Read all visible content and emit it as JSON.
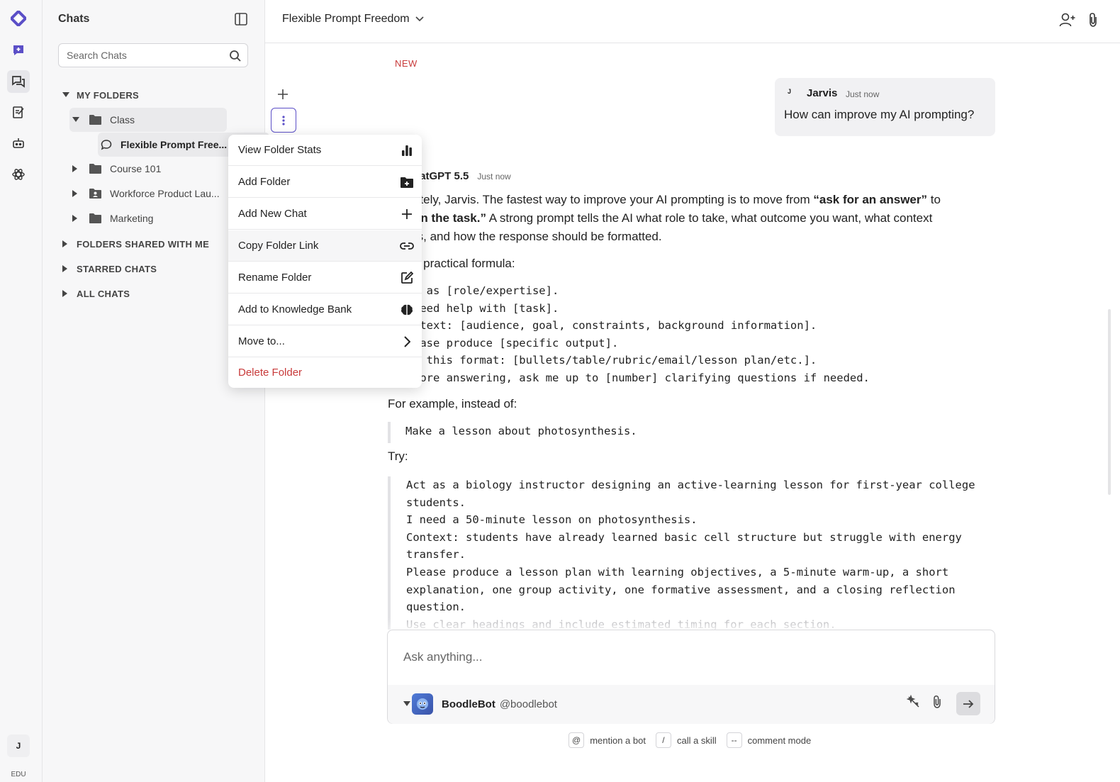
{
  "rail": {
    "user_initial": "J",
    "plan": "EDU"
  },
  "sidebar": {
    "title": "Chats",
    "search_placeholder": "Search Chats",
    "sections": {
      "my_folders": "MY FOLDERS",
      "shared": "FOLDERS SHARED WITH ME",
      "starred": "STARRED CHATS",
      "all": "ALL CHATS"
    },
    "folders": [
      {
        "label": "Class",
        "expanded": true
      },
      {
        "label": "Course 101"
      },
      {
        "label": "Workforce Product Lau..."
      },
      {
        "label": "Marketing"
      }
    ],
    "active_chat": "Flexible Prompt Free..."
  },
  "menu": {
    "items": [
      {
        "label": "View Folder Stats",
        "icon": "bar-chart-icon"
      },
      {
        "label": "Add Folder",
        "icon": "folder-plus-icon"
      },
      {
        "label": "Add New Chat",
        "icon": "plus-icon"
      },
      {
        "label": "Copy Folder Link",
        "icon": "link-icon"
      },
      {
        "label": "Rename Folder",
        "icon": "edit-icon"
      },
      {
        "label": "Add to Knowledge Bank",
        "icon": "brain-icon"
      },
      {
        "label": "Move to...",
        "icon": "chevron-right-icon"
      },
      {
        "label": "Delete Folder",
        "icon": "",
        "color": "#c83a3a"
      }
    ]
  },
  "header": {
    "title": "Flexible Prompt Freedom"
  },
  "chat": {
    "new_tag": "NEW",
    "user_message": {
      "avatar": "J",
      "name": "Jarvis",
      "time": "Just now",
      "text": "How can improve my AI prompting?"
    },
    "bot_message": {
      "name": "hatGPT 5.5",
      "time": "Just now",
      "p1_a": "utely, Jarvis. The fastest way to improve your AI prompting is to move from ",
      "p1_b": "“ask for an answer”",
      "p1_c": " to",
      "p1_d": "gn the task.”",
      "p1_e": " A strong prompt tells the AI what role to take, what outcome you want, what context",
      "p1_f": "rs, and how the response should be formatted.",
      "formula_intro": "a practical formula:",
      "formula_lines": [
        "t as [role/expertise].",
        "need help with [task].",
        "ntext: [audience, goal, constraints, background information].",
        "ease produce [specific output].",
        "e this format: [bullets/table/rubric/email/lesson plan/etc.].",
        "fore answering, ask me up to [number] clarifying questions if needed."
      ],
      "example_intro": "For example, instead of:",
      "example_bad": "Make a lesson about photosynthesis.",
      "try_label": "Try:",
      "example_good_lines": [
        "Act as a biology instructor designing an active-learning lesson for first-year college students.",
        "I need a 50-minute lesson on photosynthesis.",
        "Context: students have already learned basic cell structure but struggle with energy transfer.",
        "Please produce a lesson plan with learning objectives, a 5-minute warm-up, a short explanation, one group activity, one formative assessment, and a closing reflection question."
      ],
      "example_good_fade": "Use clear headings and include estimated timing for each section."
    }
  },
  "composer": {
    "placeholder": "Ask anything...",
    "bot_name": "BoodleBot",
    "bot_handle": "@boodlebot"
  },
  "hints": [
    {
      "key": "@",
      "label": "mention a bot"
    },
    {
      "key": "/",
      "label": "call a skill"
    },
    {
      "key": "--",
      "label": "comment mode"
    }
  ],
  "colors": {
    "accent": "#5b4fc7",
    "danger": "#c83a3a"
  }
}
